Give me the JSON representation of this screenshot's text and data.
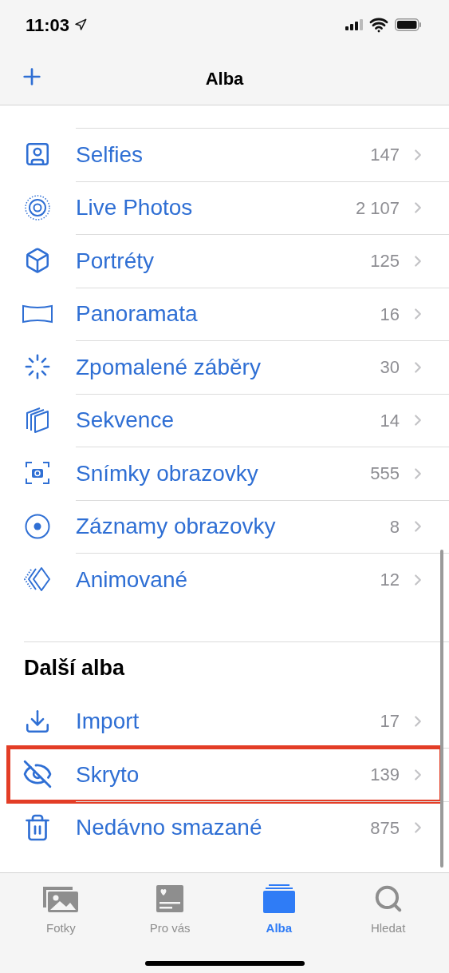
{
  "status_bar": {
    "time": "11:03"
  },
  "nav": {
    "title": "Alba"
  },
  "media_types": [
    {
      "label": "Selfies",
      "count": "147"
    },
    {
      "label": "Live Photos",
      "count": "2 107"
    },
    {
      "label": "Portréty",
      "count": "125"
    },
    {
      "label": "Panoramata",
      "count": "16"
    },
    {
      "label": "Zpomalené záběry",
      "count": "30"
    },
    {
      "label": "Sekvence",
      "count": "14"
    },
    {
      "label": "Snímky obrazovky",
      "count": "555"
    },
    {
      "label": "Záznamy obrazovky",
      "count": "8"
    },
    {
      "label": "Animované",
      "count": "12"
    }
  ],
  "other_section": {
    "title": "Další alba",
    "items": [
      {
        "label": "Import",
        "count": "17",
        "highlighted": false
      },
      {
        "label": "Skryto",
        "count": "139",
        "highlighted": true
      },
      {
        "label": "Nedávno smazané",
        "count": "875",
        "highlighted": false
      }
    ]
  },
  "tabs": [
    {
      "label": "Fotky",
      "selected": false
    },
    {
      "label": "Pro vás",
      "selected": false
    },
    {
      "label": "Alba",
      "selected": true
    },
    {
      "label": "Hledat",
      "selected": false
    }
  ]
}
